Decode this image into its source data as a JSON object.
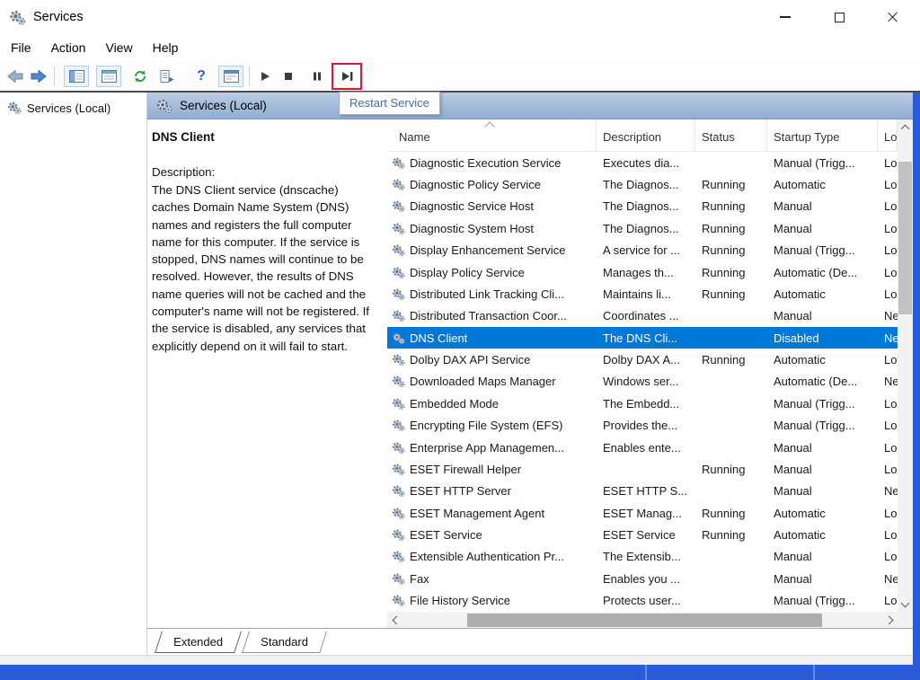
{
  "colors": {
    "selection_blue": "#0078d7",
    "frame_blue": "#2a5bd8",
    "highlight_red": "#e8112d",
    "header_steel_top": "#b9cbe4",
    "header_steel_bottom": "#92aed1"
  },
  "window": {
    "title": "Services"
  },
  "menu_items": [
    {
      "label": "File"
    },
    {
      "label": "Action"
    },
    {
      "label": "View"
    },
    {
      "label": "Help"
    }
  ],
  "toolbar": {
    "tooltip": "Restart Service",
    "help_glyph": "?"
  },
  "tree": {
    "root_label": "Services (Local)"
  },
  "panel": {
    "header": "Services (Local)"
  },
  "extended": {
    "name": "DNS Client",
    "description_label": "Description:",
    "description": "The DNS Client service (dnscache) caches Domain Name System (DNS) names and registers the full computer name for this computer. If the service is stopped, DNS names will continue to be resolved. However, the results of DNS name queries will not be cached and the computer's name will not be registered. If the service is disabled, any services that explicitly depend on it will fail to start."
  },
  "list": {
    "columns": [
      {
        "label": "Name"
      },
      {
        "label": "Description"
      },
      {
        "label": "Status"
      },
      {
        "label": "Startup Type"
      },
      {
        "label": "Lo"
      }
    ],
    "rows": [
      {
        "name": "Diagnostic Execution Service",
        "description": "Executes dia...",
        "status": "",
        "startup": "Manual (Trigg...",
        "logon": "Lo..."
      },
      {
        "name": "Diagnostic Policy Service",
        "description": "The Diagnos...",
        "status": "Running",
        "startup": "Automatic",
        "logon": "Lo..."
      },
      {
        "name": "Diagnostic Service Host",
        "description": "The Diagnos...",
        "status": "Running",
        "startup": "Manual",
        "logon": "Lo..."
      },
      {
        "name": "Diagnostic System Host",
        "description": "The Diagnos...",
        "status": "Running",
        "startup": "Manual",
        "logon": "Lo..."
      },
      {
        "name": "Display Enhancement Service",
        "description": "A service for ...",
        "status": "Running",
        "startup": "Manual (Trigg...",
        "logon": "Lo..."
      },
      {
        "name": "Display Policy Service",
        "description": "Manages th...",
        "status": "Running",
        "startup": "Automatic (De...",
        "logon": "Lo..."
      },
      {
        "name": "Distributed Link Tracking Cli...",
        "description": "Maintains li...",
        "status": "Running",
        "startup": "Automatic",
        "logon": "Lo..."
      },
      {
        "name": "Distributed Transaction Coor...",
        "description": "Coordinates ...",
        "status": "",
        "startup": "Manual",
        "logon": "Ne..."
      },
      {
        "name": "DNS Client",
        "description": "The DNS Cli...",
        "status": "",
        "startup": "Disabled",
        "logon": "Ne...",
        "selected": true
      },
      {
        "name": "Dolby DAX API Service",
        "description": "Dolby DAX A...",
        "status": "Running",
        "startup": "Automatic",
        "logon": "Lo..."
      },
      {
        "name": "Downloaded Maps Manager",
        "description": "Windows ser...",
        "status": "",
        "startup": "Automatic (De...",
        "logon": "Ne..."
      },
      {
        "name": "Embedded Mode",
        "description": "The Embedd...",
        "status": "",
        "startup": "Manual (Trigg...",
        "logon": "Lo..."
      },
      {
        "name": "Encrypting File System (EFS)",
        "description": "Provides the...",
        "status": "",
        "startup": "Manual (Trigg...",
        "logon": "Lo..."
      },
      {
        "name": "Enterprise App Managemen...",
        "description": "Enables ente...",
        "status": "",
        "startup": "Manual",
        "logon": "Lo..."
      },
      {
        "name": "ESET Firewall Helper",
        "description": "",
        "status": "Running",
        "startup": "Manual",
        "logon": "Lo..."
      },
      {
        "name": "ESET HTTP Server",
        "description": "ESET HTTP S...",
        "status": "",
        "startup": "Manual",
        "logon": "Ne..."
      },
      {
        "name": "ESET Management Agent",
        "description": "ESET Manag...",
        "status": "Running",
        "startup": "Automatic",
        "logon": "Lo..."
      },
      {
        "name": "ESET Service",
        "description": "ESET Service",
        "status": "Running",
        "startup": "Automatic",
        "logon": "Lo..."
      },
      {
        "name": "Extensible Authentication Pr...",
        "description": "The Extensib...",
        "status": "",
        "startup": "Manual",
        "logon": "Lo..."
      },
      {
        "name": "Fax",
        "description": "Enables you ...",
        "status": "",
        "startup": "Manual",
        "logon": "Ne..."
      },
      {
        "name": "File History Service",
        "description": "Protects user...",
        "status": "",
        "startup": "Manual (Trigg...",
        "logon": "Lo..."
      }
    ]
  },
  "tabs": [
    {
      "label": "Extended",
      "active": true
    },
    {
      "label": "Standard",
      "active": false
    }
  ]
}
